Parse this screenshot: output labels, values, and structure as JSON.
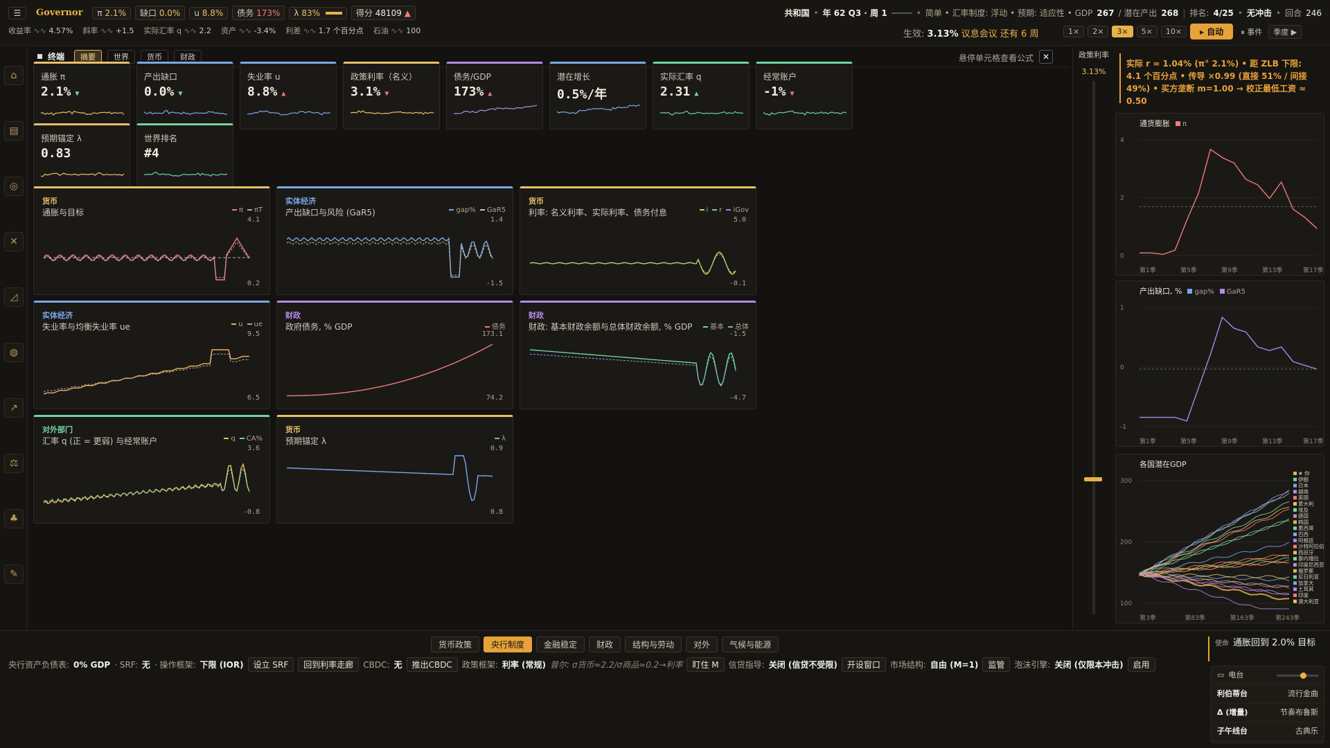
{
  "topbar": {
    "brand": "Governor",
    "chips": [
      {
        "k": "π",
        "v": "2.1%"
      },
      {
        "k": "缺口",
        "v": "0.0%"
      },
      {
        "k": "u",
        "v": "8.8%"
      },
      {
        "k": "债务",
        "v": "173%"
      },
      {
        "k": "λ",
        "v": "83%"
      }
    ],
    "score_label": "得分",
    "score_value": "48109",
    "tickers": [
      {
        "k": "收益率",
        "v": "4.57%"
      },
      {
        "k": "斜率",
        "v": "+1.5"
      },
      {
        "k": "实际汇率 q",
        "v": "2.2"
      },
      {
        "k": "资产",
        "v": "-3.4%"
      },
      {
        "k": "利差",
        "v": "1.7 个百分点"
      },
      {
        "k": "石油",
        "v": "100"
      }
    ],
    "country": "共和国",
    "date": "年 62 Q3 · 周 1",
    "regime": "简单 • 汇率制度: 浮动 • 预期: 适应性 • GDP",
    "gdp": "267",
    "potential_label": "/ 潜在产出",
    "potential": "268",
    "rank_label": "排名:",
    "rank": "4/25",
    "shock": "无冲击",
    "round_label": "回合",
    "round": "246",
    "effective_label": "生效:",
    "effective": "3.13%",
    "meeting": "议息会议 还有 6 周",
    "speeds": [
      "1×",
      "2×",
      "3×",
      "5×",
      "10×"
    ],
    "speed_active": "3×",
    "auto": "▸ 自动",
    "pause": "⏸ 事件",
    "season": "季度 ▶"
  },
  "terminal": {
    "title": "终端",
    "tabs": [
      "摘要",
      "世界",
      "货币",
      "财政"
    ],
    "active_tab": "摘要",
    "hint": "悬停单元格查看公式"
  },
  "kpis": [
    {
      "label": "通胀 π",
      "value": "2.1%",
      "dir": "▼",
      "dircolor": "#86d49a",
      "color": "#e8c068",
      "line": "#e8c068"
    },
    {
      "label": "产出缺口",
      "value": "0.0%",
      "dir": "▼",
      "dircolor": "#86d49a",
      "color": "#7aa8e8",
      "line": "#7aa8e8"
    },
    {
      "label": "失业率 u",
      "value": "8.8%",
      "dir": "▲",
      "dircolor": "#f07b7b",
      "color": "#7aa8e8",
      "line": "#7aa8e8"
    },
    {
      "label": "政策利率（名义）",
      "value": "3.1%",
      "dir": "▼",
      "dircolor": "#f07b7b",
      "color": "#e8c068",
      "line": "#e8c068"
    },
    {
      "label": "债务/GDP",
      "value": "173%",
      "dir": "▲",
      "dircolor": "#f07b7b",
      "color": "#b58ae8",
      "line": "#b58ae8"
    },
    {
      "label": "潜在增长",
      "value": "0.5%/年",
      "dir": "",
      "dircolor": "#86d49a",
      "color": "#7aa8e8",
      "line": "#7aa8e8"
    },
    {
      "label": "实际汇率 q",
      "value": "2.31",
      "dir": "▲",
      "dircolor": "#86d49a",
      "color": "#6fd4a0",
      "line": "#6fd4a0"
    },
    {
      "label": "经常账户",
      "value": "-1%",
      "dir": "▼",
      "dircolor": "#f07b7b",
      "color": "#6fd4a0",
      "line": "#6fd4a0"
    },
    {
      "label": "预期锚定 λ",
      "value": "0.83",
      "dir": "",
      "dircolor": "#86d49a",
      "color": "#e8c068",
      "line": "#e8c068"
    },
    {
      "label": "世界排名",
      "value": "#4",
      "dir": "",
      "dircolor": "#86d49a",
      "color": "#6fd4a0",
      "line": "#6fd4a0"
    }
  ],
  "panels": [
    {
      "cat": "货币",
      "catcolor": "#e8c068",
      "title": "通胀与目标",
      "legend": [
        {
          "n": "π",
          "c": "#f07b7b"
        },
        {
          "n": "πT",
          "c": "#aaa"
        }
      ],
      "max": "4.1",
      "min": "0.2",
      "color": "#e8c068"
    },
    {
      "cat": "实体经济",
      "catcolor": "#7aa8e8",
      "title": "产出缺口与风险 (GaR5)",
      "legend": [
        {
          "n": "gap%",
          "c": "#7aa8e8"
        },
        {
          "n": "GaR5",
          "c": "#d6c0a0"
        }
      ],
      "max": "1.4",
      "min": "-1.5",
      "color": "#7aa8e8"
    },
    {
      "cat": "货币",
      "catcolor": "#e8c068",
      "title": "利率: 名义利率、实际利率、债务付息",
      "legend": [
        {
          "n": "i",
          "c": "#e8c068"
        },
        {
          "n": "r",
          "c": "#6fd4a0"
        },
        {
          "n": "iGov",
          "c": "#a48ae8"
        }
      ],
      "max": "5.0",
      "min": "-0.1",
      "color": "#e8c068"
    },
    {
      "cat": "实体经济",
      "catcolor": "#7aa8e8",
      "title": "失业率与均衡失业率 ue",
      "legend": [
        {
          "n": "u",
          "c": "#f0b060"
        },
        {
          "n": "ue",
          "c": "#aaa"
        }
      ],
      "max": "9.5",
      "min": "6.5",
      "color": "#7aa8e8"
    },
    {
      "cat": "财政",
      "catcolor": "#b58ae8",
      "title": "政府债务, % GDP",
      "legend": [
        {
          "n": "债务",
          "c": "#f07b7b"
        }
      ],
      "max": "173.1",
      "min": "74.2",
      "color": "#b58ae8"
    },
    {
      "cat": "财政",
      "catcolor": "#b58ae8",
      "title": "财政: 基本财政余额与总体财政余额, % GDP",
      "legend": [
        {
          "n": "基本",
          "c": "#6fd4a0"
        },
        {
          "n": "总体",
          "c": "#7aa8e8"
        }
      ],
      "max": "-1.5",
      "min": "-4.7",
      "color": "#b58ae8"
    },
    {
      "cat": "对外部门",
      "catcolor": "#6fd4a0",
      "title": "汇率 q (正 = 更弱) 与经常账户",
      "legend": [
        {
          "n": "q",
          "c": "#e8c068"
        },
        {
          "n": "CA%",
          "c": "#6fd4a0"
        }
      ],
      "max": "3.6",
      "min": "-0.8",
      "color": "#6fd4a0"
    },
    {
      "cat": "货币",
      "catcolor": "#e8c068",
      "title": "预期锚定 λ",
      "legend": [
        {
          "n": "λ",
          "c": "#7aa8e8"
        }
      ],
      "max": "0.9",
      "min": "0.8",
      "color": "#e8c068"
    }
  ],
  "policy_rate": {
    "label": "政策利率",
    "value": "3.13%"
  },
  "right_note": "实际 r ≈ 1.04% (π° 2.1%) • 距 ZLB 下限: 4.1 个百分点 • 传导 ×0.99 (直接 51% / 间接 49%) • 买方垄断 m=1.00 → 校正最低工资 ≈ 0.50",
  "rcharts": [
    {
      "title": "通货膨胀",
      "leg": "π",
      "legc": "#f07b7b",
      "y": [
        "4",
        "2",
        "0"
      ],
      "x": [
        "第1季",
        "第5季",
        "第9季",
        "第13季",
        "第17季"
      ],
      "chart_data": {
        "type": "line",
        "series": [
          {
            "name": "π",
            "values": [
              0.3,
              0.3,
              0.25,
              0.4,
              1.5,
              2.5,
              4.1,
              3.8,
              3.6,
              3.0,
              2.8,
              2.3,
              2.9,
              1.9,
              1.6,
              1.2
            ]
          }
        ],
        "ylim": [
          0,
          4.5
        ]
      }
    },
    {
      "title": "产出缺口, %",
      "leg": "gap%",
      "legc": "#7aa8e8",
      "leg2": "GaR5",
      "leg2c": "#b58ae8",
      "y": [
        "1",
        "0",
        "-1"
      ],
      "x": [
        "第1季",
        "第5季",
        "第9季",
        "第13季",
        "第17季"
      ],
      "chart_data": {
        "type": "line",
        "series": [
          {
            "name": "gap%",
            "values": [
              -1.3,
              -1.3,
              -1.3,
              -1.3,
              -1.4,
              -0.5,
              0.4,
              1.4,
              1.1,
              1.0,
              0.6,
              0.5,
              0.6,
              0.2,
              0.1,
              0.0
            ]
          }
        ],
        "ylim": [
          -1.7,
          1.7
        ]
      }
    },
    {
      "title": "各国潜在GDP",
      "y": [
        "300",
        "200",
        "100"
      ],
      "x": [
        "第3季",
        "第83季",
        "第163季",
        "第243季"
      ],
      "countries": [
        "★ 你",
        "伊朗",
        "日本",
        "越南",
        "英国",
        "意大利",
        "埃及",
        "德国",
        "韩国",
        "墨西哥",
        "巴西",
        "阿根廷",
        "沙特阿拉伯",
        "西班牙",
        "泰内瑞拉",
        "印度尼西亚",
        "俄罗斯",
        "尼日利亚",
        "加拿大",
        "土耳其",
        "印度",
        "澳大利亚"
      ]
    }
  ],
  "bottom": {
    "tabs": [
      "货币政策",
      "央行制度",
      "金融稳定",
      "财政",
      "结构与劳动",
      "对外",
      "气候与能源"
    ],
    "active": "央行制度",
    "row": [
      {
        "t": "label",
        "v": "央行资产负债表:"
      },
      {
        "t": "bold",
        "v": "0% GDP"
      },
      {
        "t": "label",
        "v": "· SRF:"
      },
      {
        "t": "bold",
        "v": "无"
      },
      {
        "t": "label",
        "v": "· 操作框架:"
      },
      {
        "t": "bold",
        "v": "下限 (IOR)"
      },
      {
        "t": "btn",
        "v": "设立 SRF"
      },
      {
        "t": "btn",
        "v": "回到利率走廊"
      },
      {
        "t": "label",
        "v": "CBDC:"
      },
      {
        "t": "bold",
        "v": "无"
      },
      {
        "t": "btn",
        "v": "推出CBDC"
      },
      {
        "t": "label",
        "v": "政策框架:"
      },
      {
        "t": "bold",
        "v": "利率 (常规)"
      },
      {
        "t": "ital",
        "v": "普尔: σ货币≈2.2/σ商品≈0.2→利率"
      },
      {
        "t": "btn",
        "v": "盯住 M"
      },
      {
        "t": "label",
        "v": "信贷指导:"
      },
      {
        "t": "bold",
        "v": "关闭 (信贷不受限)"
      },
      {
        "t": "btn",
        "v": "开设窗口"
      },
      {
        "t": "label",
        "v": "市场结构:"
      },
      {
        "t": "bold",
        "v": "自由 (M=1)"
      },
      {
        "t": "btn",
        "v": "监管"
      },
      {
        "t": "label",
        "v": "泡沫引擎:"
      },
      {
        "t": "bold",
        "v": "关闭 (仅限本冲击)"
      },
      {
        "t": "btn",
        "v": "启用"
      }
    ],
    "mission_label": "使命",
    "mission": "通胀回到 2.0% 目标",
    "radio": {
      "label": "电台",
      "stations": [
        {
          "k": "利伯蒂台",
          "v": "流行金曲"
        },
        {
          "k": "Δ (增量)",
          "v": "节奏布鲁斯"
        },
        {
          "k": "子午线台",
          "v": "古典乐"
        }
      ]
    }
  }
}
